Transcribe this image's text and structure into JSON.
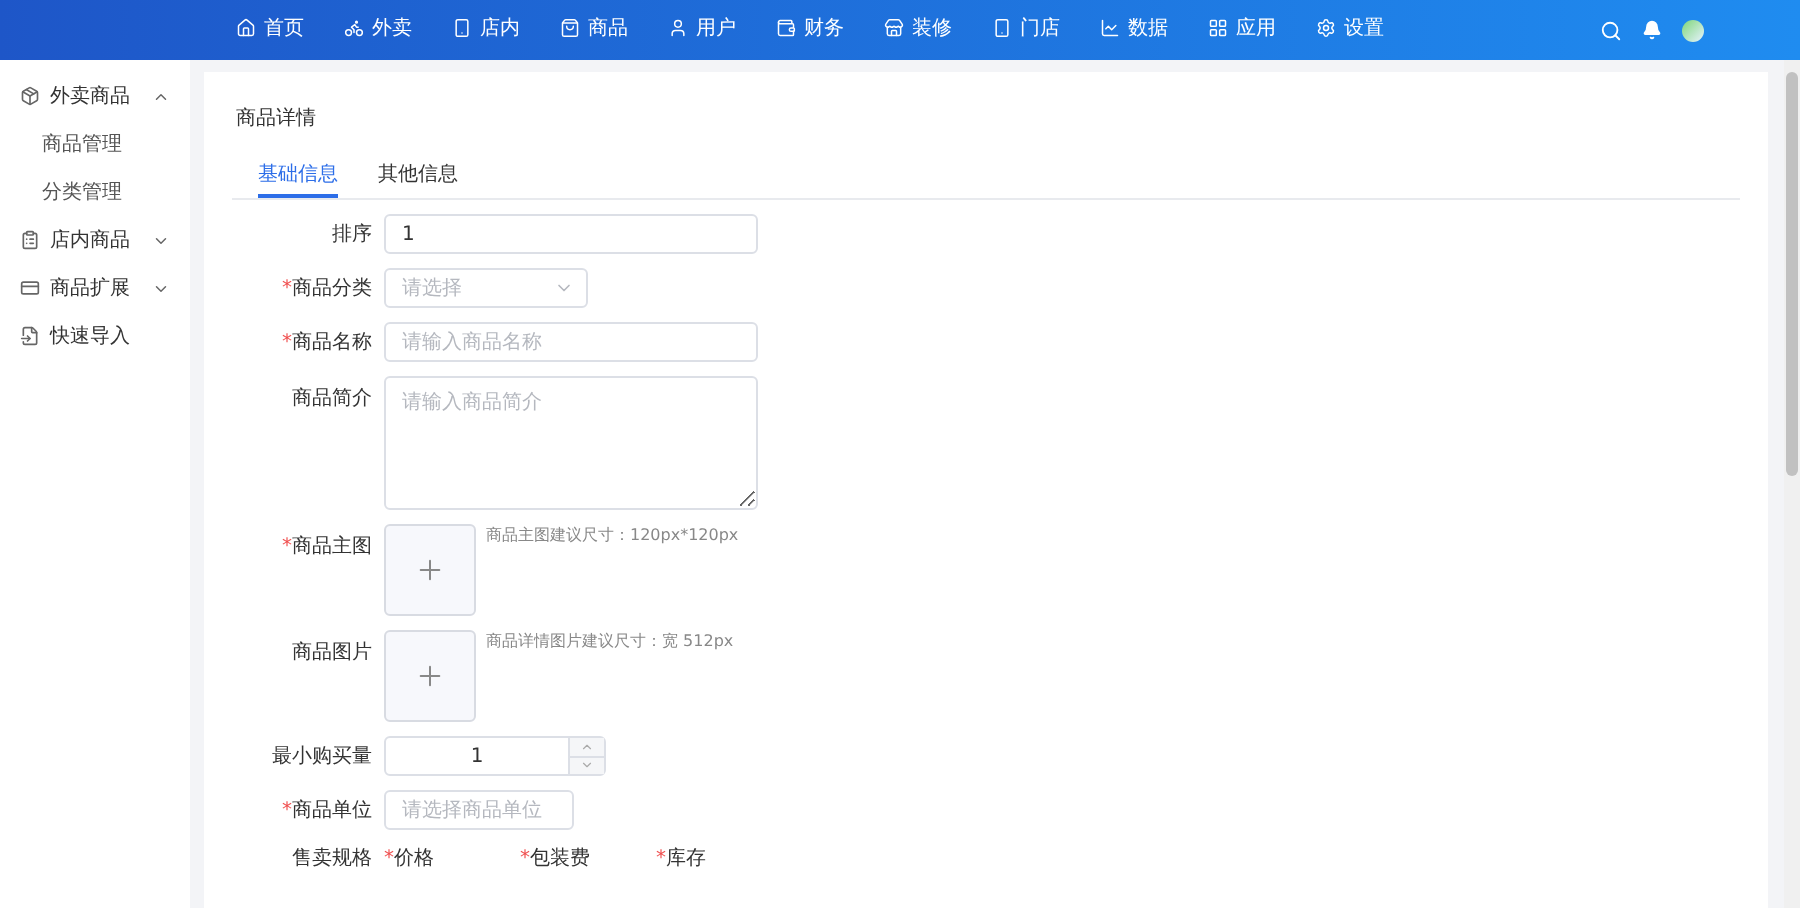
{
  "top_nav": {
    "items": [
      {
        "label": "首页"
      },
      {
        "label": "外卖"
      },
      {
        "label": "店内"
      },
      {
        "label": "商品"
      },
      {
        "label": "用户"
      },
      {
        "label": "财务"
      },
      {
        "label": "装修"
      },
      {
        "label": "门店"
      },
      {
        "label": "数据"
      },
      {
        "label": "应用"
      },
      {
        "label": "设置"
      }
    ]
  },
  "sidebar": {
    "items": [
      {
        "label": "外卖商品",
        "expanded": true,
        "children": [
          {
            "label": "商品管理"
          },
          {
            "label": "分类管理"
          }
        ]
      },
      {
        "label": "店内商品",
        "expanded": false
      },
      {
        "label": "商品扩展",
        "expanded": false
      },
      {
        "label": "快速导入"
      }
    ]
  },
  "page_title": "商品详情",
  "tabs": [
    {
      "label": "基础信息",
      "selected": true
    },
    {
      "label": "其他信息",
      "selected": false
    }
  ],
  "form": [
    {
      "kind": "input",
      "label": "排序",
      "value": "1"
    },
    {
      "kind": "select",
      "required_mark": "*",
      "label": "商品分类",
      "placeholder": "请选择"
    },
    {
      "kind": "input",
      "required_mark": "*",
      "label": "商品名称",
      "placeholder": "请输入商品名称"
    },
    {
      "kind": "textarea",
      "label": "商品简介",
      "placeholder": "请输入商品简介"
    },
    {
      "kind": "upload",
      "required_mark": "*",
      "label": "商品主图",
      "hint": "商品主图建议尺寸：120px*120px"
    },
    {
      "kind": "upload",
      "label": "商品图片",
      "hint": "商品详情图片建议尺寸：宽 512px"
    },
    {
      "kind": "number",
      "label": "最小购买量",
      "value": "1"
    },
    {
      "kind": "short_input",
      "required_mark": "*",
      "label": "商品单位",
      "placeholder": "请选择商品单位"
    },
    {
      "kind": "specs",
      "label": "售卖规格",
      "columns": [
        {
          "required_mark": "*",
          "label": "价格"
        },
        {
          "required_mark": "*",
          "label": "包装费"
        },
        {
          "required_mark": "*",
          "label": "库存"
        }
      ]
    }
  ]
}
